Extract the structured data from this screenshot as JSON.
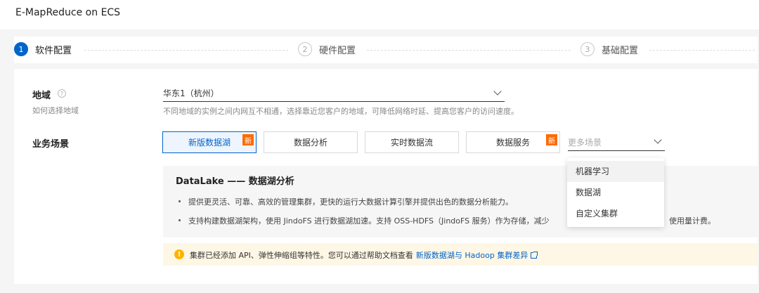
{
  "app": {
    "title": "E-MapReduce on ECS"
  },
  "steps": [
    {
      "num": "1",
      "label": "软件配置"
    },
    {
      "num": "2",
      "label": "硬件配置"
    },
    {
      "num": "3",
      "label": "基础配置"
    }
  ],
  "region": {
    "label": "地域",
    "help_link": "如何选择地域",
    "value": "华东1（杭州）",
    "hint": "不同地域的实例之间内网互不相通，选择靠近您客户的地域，可降低网络时延、提高您客户的访问速度。"
  },
  "scenario": {
    "label": "业务场景",
    "options": [
      {
        "label": "新版数据湖",
        "badge": "新"
      },
      {
        "label": "数据分析"
      },
      {
        "label": "实时数据流"
      },
      {
        "label": "数据服务",
        "badge": "新"
      }
    ],
    "more_placeholder": "更多场景",
    "more_options": [
      "机器学习",
      "数据湖",
      "自定义集群"
    ]
  },
  "description": {
    "title": "DataLake —— 数据湖分析",
    "bullets": [
      "提供更灵活、可靠、高效的管理集群，更快的运行大数据计算引擎并提供出色的数据分析能力。",
      "支持构建数据湖架构，使用 JindoFS 进行数据湖加速。支持 OSS-HDFS（JindoFS 服务）作为存储，减少",
      "使用量计费。"
    ]
  },
  "notice": {
    "icon": "!",
    "text": "集群已经添加 API、弹性伸缩组等特性。您可以通过帮助文档查看",
    "link": "新版数据湖与 Hadoop 集群差异"
  },
  "colors": {
    "primary": "#0064c8",
    "badge": "#ff6a00",
    "notice_bg": "#fff7e6",
    "warning": "#ffb300"
  }
}
